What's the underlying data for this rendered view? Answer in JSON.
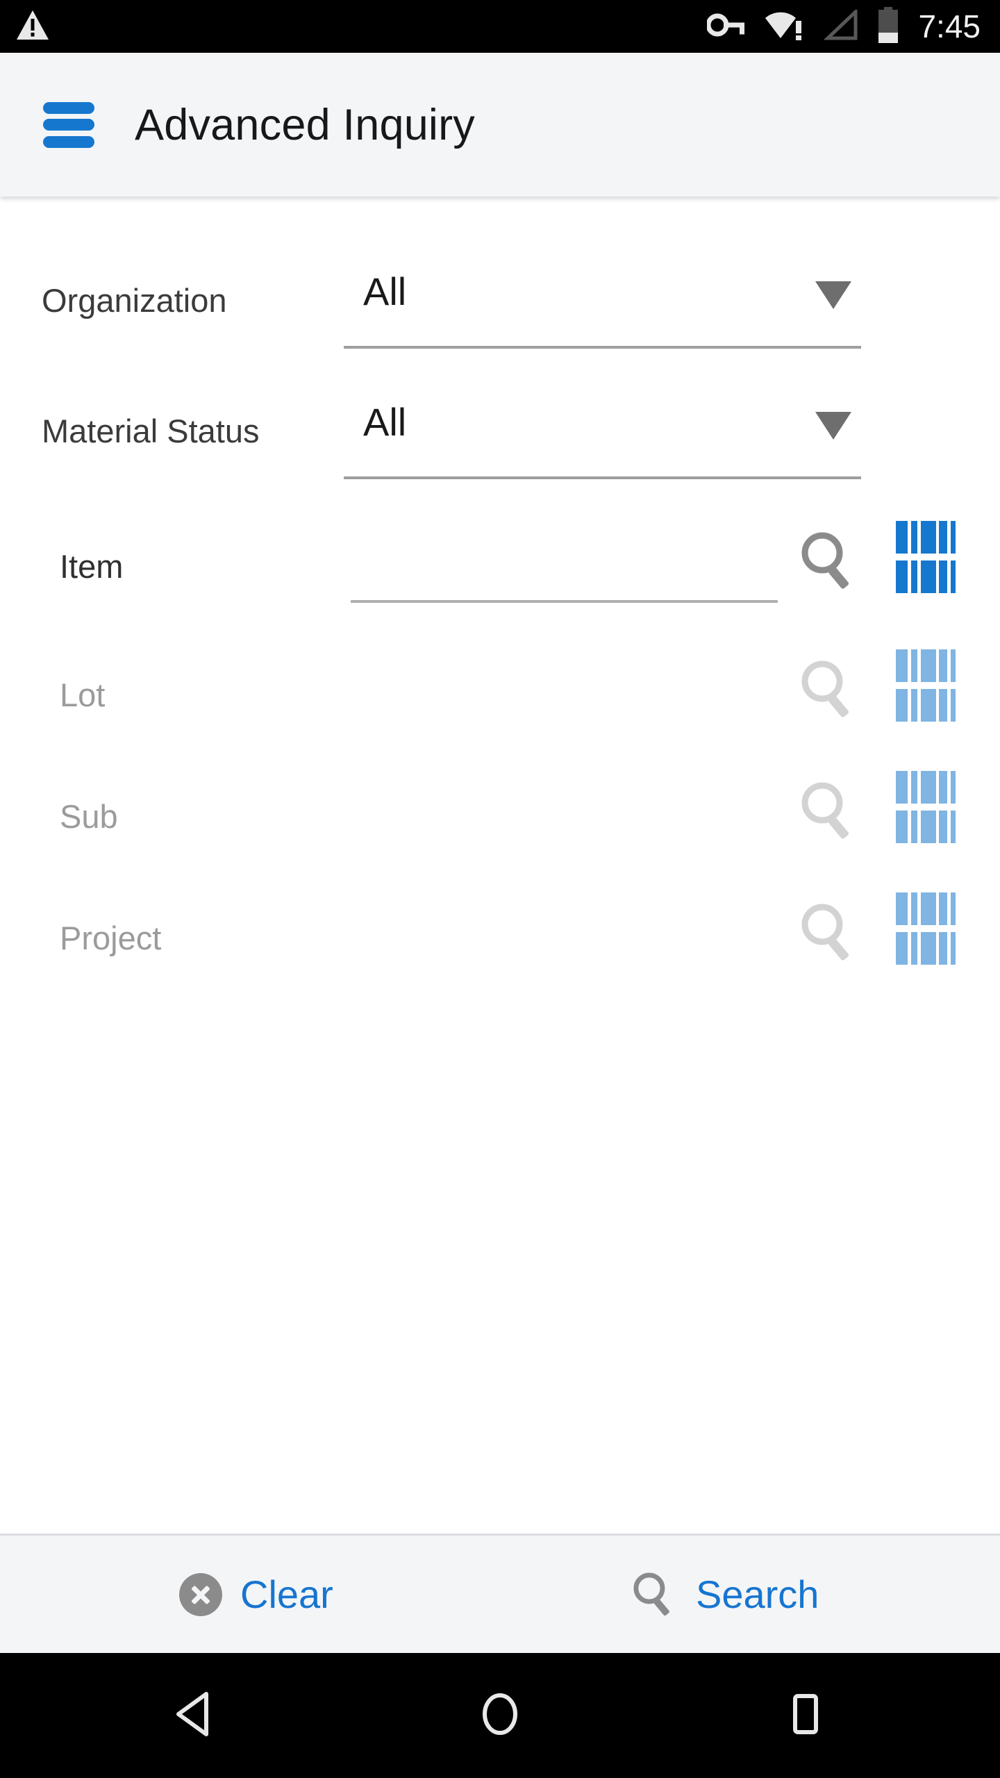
{
  "status_bar": {
    "icons": [
      "vpn-key-icon",
      "wifi-warning-icon",
      "cell-signal-empty-icon",
      "battery-icon"
    ],
    "clock": "7:45"
  },
  "header": {
    "menu_icon": "hamburger-menu-icon",
    "title": "Advanced Inquiry"
  },
  "form": {
    "dropdowns": [
      {
        "label": "Organization",
        "value": "All",
        "caret": "chevron-down-icon"
      },
      {
        "label": "Material Status",
        "value": "All",
        "caret": "chevron-down-icon"
      }
    ],
    "search_rows": [
      {
        "label": "Item",
        "value": "",
        "enabled": true,
        "search_icon": "magnifier-icon",
        "barcode_icon": "barcode-icon"
      },
      {
        "label": "Lot",
        "value": "",
        "enabled": false,
        "search_icon": "magnifier-icon",
        "barcode_icon": "barcode-icon"
      },
      {
        "label": "Sub",
        "value": "",
        "enabled": false,
        "search_icon": "magnifier-icon",
        "barcode_icon": "barcode-icon"
      },
      {
        "label": "Project",
        "value": "",
        "enabled": false,
        "search_icon": "magnifier-icon",
        "barcode_icon": "barcode-icon"
      }
    ]
  },
  "action_bar": {
    "clear_label": "Clear",
    "clear_icon": "circle-close-icon",
    "search_label": "Search",
    "search_icon": "magnifier-icon"
  },
  "nav_bar": {
    "back_icon": "triangle-back-icon",
    "home_icon": "circle-home-icon",
    "recents_icon": "square-recents-icon"
  },
  "colors": {
    "accent_blue": "#1578ce",
    "link_blue": "#1675d0",
    "barcode_disabled": "#7fb4e3",
    "icon_gray": "#8b8b8b",
    "icon_gray_disabled": "#d3d3d3",
    "appbar_bg": "#f4f5f7",
    "label_text": "#303030",
    "label_disabled": "#9b9b9b"
  }
}
